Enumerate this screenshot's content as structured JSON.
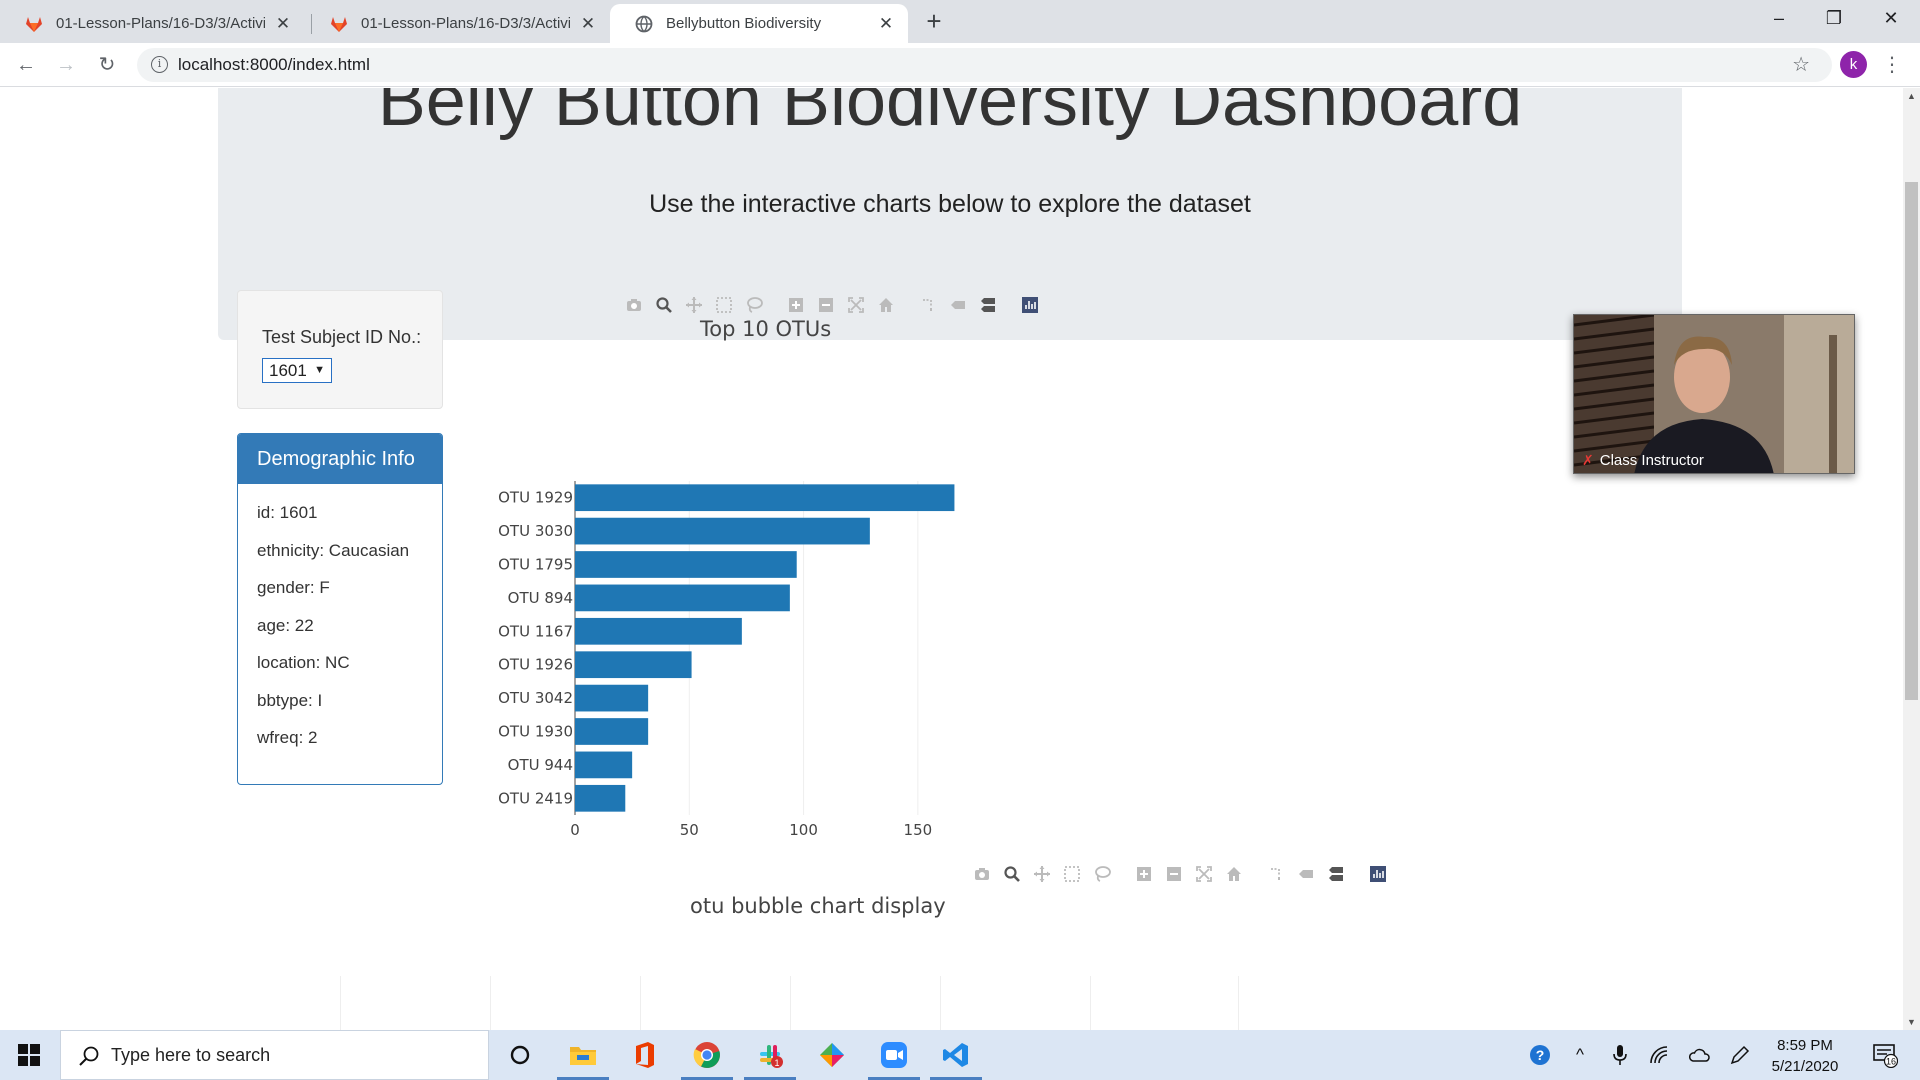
{
  "browser": {
    "tabs": [
      {
        "title": "01-Lesson-Plans/16-D3/3/Activiti",
        "active": false,
        "favicon": "gitlab-icon"
      },
      {
        "title": "01-Lesson-Plans/16-D3/3/Activiti",
        "active": false,
        "favicon": "gitlab-icon"
      },
      {
        "title": "Bellybutton Biodiversity",
        "active": true,
        "favicon": "globe-icon"
      }
    ],
    "url": "localhost:8000/index.html",
    "profile_initial": "k"
  },
  "page": {
    "title": "Belly Button Biodiversity Dashboard",
    "subtitle": "Use the interactive charts below to explore the dataset",
    "selector": {
      "label": "Test Subject ID No.:",
      "selected": "1601"
    },
    "demographic": {
      "heading": "Demographic Info",
      "rows": [
        "id: 1601",
        "ethnicity: Caucasian",
        "gender: F",
        "age: 22",
        "location: NC",
        "bbtype: I",
        "wfreq: 2"
      ]
    },
    "bar_chart_title": "Top 10 OTUs",
    "bubble_chart_title": "otu bubble chart display"
  },
  "chart_data": {
    "type": "bar",
    "orientation": "horizontal",
    "title": "Top 10 OTUs",
    "categories": [
      "OTU 1929",
      "OTU 3030",
      "OTU 1795",
      "OTU 894",
      "OTU 1167",
      "OTU 1926",
      "OTU 3042",
      "OTU 1930",
      "OTU 944",
      "OTU 2419"
    ],
    "values": [
      166,
      129,
      97,
      94,
      73,
      51,
      32,
      32,
      25,
      22
    ],
    "xticks": [
      0,
      50,
      100,
      150
    ],
    "xlim": [
      0,
      175
    ],
    "color": "#1f77b4",
    "grid": true
  },
  "video": {
    "name": "Class Instructor"
  },
  "taskbar": {
    "search_placeholder": "Type here to search",
    "time": "8:59 PM",
    "date": "5/21/2020",
    "notification_count": "16"
  }
}
